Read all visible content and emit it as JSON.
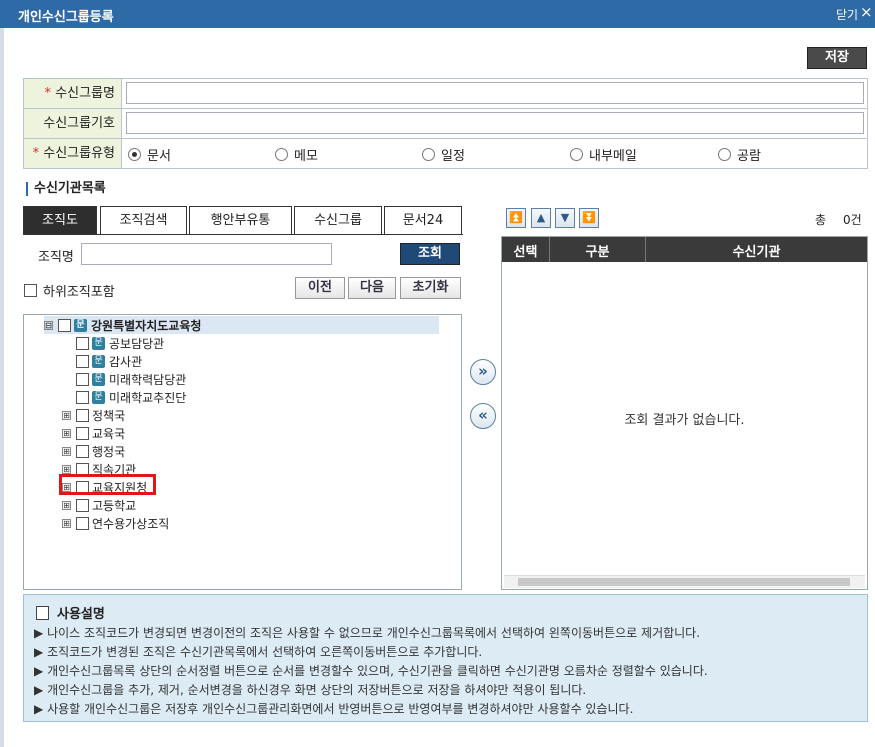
{
  "window": {
    "title": "개인수신그룹등록",
    "close_label": "닫기",
    "close_icon": "×"
  },
  "toolbar": {
    "save_label": "저장"
  },
  "form": {
    "name_label": "수신그룹명",
    "code_label": "수신그룹기호",
    "type_label": "수신그룹유형",
    "required_mark": "*",
    "name_value": "",
    "code_value": "",
    "types": [
      "문서",
      "메모",
      "일정",
      "내부메일",
      "공람"
    ],
    "selected_type": "문서"
  },
  "section_title": "수신기관목록",
  "tabs": [
    "조직도",
    "조직검색",
    "행안부유통",
    "수신그룹",
    "문서24"
  ],
  "active_tab": "조직도",
  "search": {
    "label": "조직명",
    "value": "",
    "button": "조회"
  },
  "sub_org_label": "하위조직포함",
  "nav_buttons": {
    "prev": "이전",
    "next": "다음",
    "reset": "초기화"
  },
  "tree": {
    "root": "강원특별자치도교육청",
    "doc_icon_text": "문",
    "collapse_symbol": "⊟",
    "expand_symbol": "⊞",
    "leaf_children": [
      "공보담당관",
      "감사관",
      "미래학력담당관",
      "미래학교추진단"
    ],
    "branch_children": [
      "정책국",
      "교육국",
      "행정국",
      "직속기관",
      "교육지원청",
      "고등학교",
      "연수용가상조직"
    ],
    "highlighted": "교육지원청"
  },
  "order_buttons": [
    "⏫",
    "▲",
    "▼",
    "⏬"
  ],
  "transfer_buttons": {
    "add": "»",
    "remove": "«"
  },
  "total": {
    "label": "총",
    "count": "0건"
  },
  "grid": {
    "headers": [
      "선택",
      "구분",
      "수신기관"
    ],
    "empty_message": "조회 결과가 없습니다."
  },
  "help": {
    "title": "사용설명",
    "bullet": "▶",
    "lines": [
      "나이스 조직코드가 변경되면 변경이전의 조직은 사용할 수 없으므로 개인수신그룹목록에서 선택하여 왼쪽이동버튼으로 제거합니다.",
      "조직코드가 변경된 조직은 수신기관목록에서 선택하여 오른쪽이동버튼으로 추가합니다.",
      "개인수신그룹목록 상단의 순서정렬 버튼으로 순서를 변경할수 있으며, 수신기관을 클릭하면 수신기관명 오름차순 정렬할수 있습니다.",
      "개인수신그룹을 추가, 제거, 순서변경을 하신경우 화면 상단의 저장버튼으로 저장을 하셔야만 적용이 됩니다.",
      "사용할 개인수신그룹은 저장후 개인수신그룹관리화면에서 반영버튼으로 반영여부를 변경하셔야만 사용할수 있습니다."
    ]
  },
  "colors": {
    "titlebar": "#2e6aa6",
    "label_bg": "#eef3dd",
    "help_bg": "#dcebf4",
    "highlight": "#e4141b"
  }
}
